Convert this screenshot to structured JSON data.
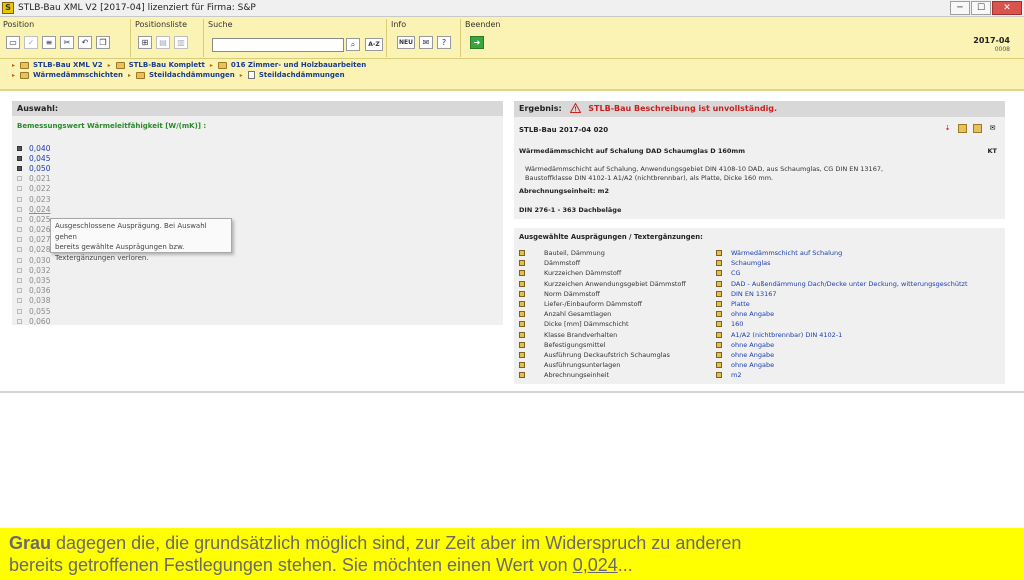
{
  "window": {
    "title": "STLB-Bau XML V2 [2017-04] lizenziert für Firma: S&P",
    "app_icon_letter": "S",
    "btn_min": "─",
    "btn_max": "☐",
    "btn_close": "✕"
  },
  "toolbar": {
    "groups": {
      "position": "Position",
      "positionsliste": "Positionsliste",
      "suche": "Suche",
      "info": "Info",
      "beenden": "Beenden"
    },
    "search_value": "",
    "az_label": "A-Z",
    "new_label": "NEU",
    "help_label": "?",
    "version": "2017-04",
    "version_sub": "0008"
  },
  "breadcrumb": {
    "row1": [
      "STLB-Bau XML V2",
      "STLB-Bau Komplett",
      "016 Zimmer- und Holzbauarbeiten"
    ],
    "row2": [
      "Wärmedämmschichten",
      "Steildachdämmungen",
      "Steildachdämmungen"
    ]
  },
  "left": {
    "header": "Auswahl:",
    "attribute_title": "Bemessungswert Wärmeleitfähigkeit [W/(mK)] :",
    "values": [
      "0,040",
      "0,045",
      "0,050",
      "0,021",
      "0,022",
      "0,023",
      "0,024",
      "0,025",
      "0,026",
      "0,027",
      "0,028",
      "0,030",
      "0,032",
      "0,035",
      "0,036",
      "0,038",
      "0,055",
      "0,060"
    ],
    "tooltip": {
      "line1": "Ausgeschlossene Ausprägung. Bei Auswahl gehen",
      "line2": "bereits gewählte Ausprägungen bzw.",
      "line3": "Textergänzungen verloren."
    }
  },
  "result": {
    "header_label": "Ergebnis:",
    "header_warning": "STLB-Bau Beschreibung ist unvollständig.",
    "title": "STLB-Bau 2017-04 020",
    "short_text": "Wärmedämmschicht auf Schalung DAD Schaumglas D 160mm",
    "kt": "KT",
    "long_text_1": "Wärmedämmschicht auf Schalung, Anwendungsgebiet DIN 4108-10 DAD, aus Schaumglas, CG DIN EN 13167,",
    "long_text_2": "Baustoffklasse DIN 4102-1 A1/A2 (nichtbrennbar), als Platte, Dicke 160 mm.",
    "unit": "Abrechnungseinheit: m2",
    "din": "DIN 276-1 - 363 Dachbeläge",
    "icon_pdf": "⇣",
    "icon_mail": "✉"
  },
  "selected": {
    "header": "Ausgewählte Ausprägungen / Textergänzungen:",
    "rows": [
      {
        "name": "Bauteil, Dämmung",
        "value": "Wärmedämmschicht auf Schalung"
      },
      {
        "name": "Dämmstoff",
        "value": "Schaumglas"
      },
      {
        "name": "Kurzzeichen Dämmstoff",
        "value": "CG"
      },
      {
        "name": "Kurzzeichen Anwendungsgebiet Dämmstoff",
        "value": "DAD - Außendämmung Dach/Decke unter Deckung, witterungsgeschützt"
      },
      {
        "name": "Norm Dämmstoff",
        "value": "DIN EN 13167"
      },
      {
        "name": "Liefer-/Einbauform Dämmstoff",
        "value": "Platte"
      },
      {
        "name": "Anzahl Gesamtlagen",
        "value": "ohne Angabe"
      },
      {
        "name": "Dicke [mm] Dämmschicht",
        "value": "160"
      },
      {
        "name": "Klasse Brandverhalten",
        "value": "A1/A2 (nichtbrennbar) DIN 4102-1"
      },
      {
        "name": "Befestigungsmittel",
        "value": "ohne Angabe"
      },
      {
        "name": "Ausführung Deckaufstrich Schaumglas",
        "value": "ohne Angabe"
      },
      {
        "name": "Ausführungsunterlagen",
        "value": "ohne Angabe"
      },
      {
        "name": "Abrechnungseinheit",
        "value": "m2"
      }
    ]
  },
  "caption": {
    "bold": "Grau",
    "line1_rest": " dagegen die, die grundsätzlich möglich sind, zur Zeit aber im Widerspruch zu anderen",
    "line2_start": "bereits getroffenen Festlegungen stehen. Sie möchten einen Wert von ",
    "line2_underlined": "0,024",
    "line2_end": "..."
  }
}
